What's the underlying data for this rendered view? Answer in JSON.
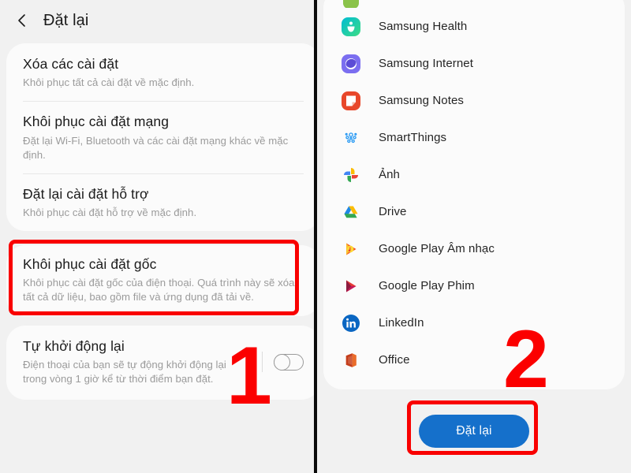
{
  "colors": {
    "accent_blue": "#1570cb",
    "highlight_red": "#f90000",
    "page_background": "#f1f1f1",
    "card_background": "#fbfbfb",
    "title_text": "#1b1b1b",
    "description_text": "#9b9b9b"
  },
  "left_panel": {
    "header": {
      "back_icon": "chevron-left-icon",
      "title": "Đặt lại"
    },
    "settings_groups": [
      {
        "group_name": "general-reset-group",
        "items": [
          {
            "title": "Xóa các cài đặt",
            "description": "Khôi phục tất cả cài đặt về mặc định."
          },
          {
            "title": "Khôi phục cài đặt mạng",
            "description": "Đặt lại Wi-Fi, Bluetooth và các cài đặt mạng khác về mặc định."
          },
          {
            "title": "Đặt lại cài đặt hỗ trợ",
            "description": "Khôi phục cài đặt hỗ trợ về mặc định."
          }
        ]
      },
      {
        "group_name": "factory-reset-group",
        "highlighted": true,
        "items": [
          {
            "title": "Khôi phục cài đặt gốc",
            "description": "Khôi phục cài đặt gốc của điện thoại. Quá trình này sẽ xóa tất cả dữ liệu, bao gồm file và ứng dụng đã tải về."
          }
        ]
      },
      {
        "group_name": "auto-restart-group",
        "items": [
          {
            "title": "Tự khởi động lại",
            "description": "Điện thoại của bạn sẽ tự động khởi động lại trong vòng 1 giờ kể từ thời điểm bạn đặt.",
            "toggle": {
              "name": "auto-restart-toggle",
              "state": "off"
            }
          }
        ]
      }
    ],
    "step_badge": "1"
  },
  "right_panel": {
    "apps": [
      {
        "label": "",
        "icon": "partial-app-icon",
        "partial": true
      },
      {
        "label": "Samsung Health",
        "icon": "samsung-health-icon"
      },
      {
        "label": "Samsung Internet",
        "icon": "samsung-internet-icon"
      },
      {
        "label": "Samsung Notes",
        "icon": "samsung-notes-icon"
      },
      {
        "label": "SmartThings",
        "icon": "smartthings-icon"
      },
      {
        "label": "Ảnh",
        "icon": "google-photos-icon"
      },
      {
        "label": "Drive",
        "icon": "google-drive-icon"
      },
      {
        "label": "Google Play Âm nhạc",
        "icon": "google-play-music-icon"
      },
      {
        "label": "Google Play Phim",
        "icon": "google-play-movies-icon"
      },
      {
        "label": "LinkedIn",
        "icon": "linkedin-icon"
      },
      {
        "label": "Office",
        "icon": "microsoft-office-icon"
      }
    ],
    "action_button": {
      "label": "Đặt lại",
      "highlighted": true
    },
    "step_badge": "2"
  }
}
